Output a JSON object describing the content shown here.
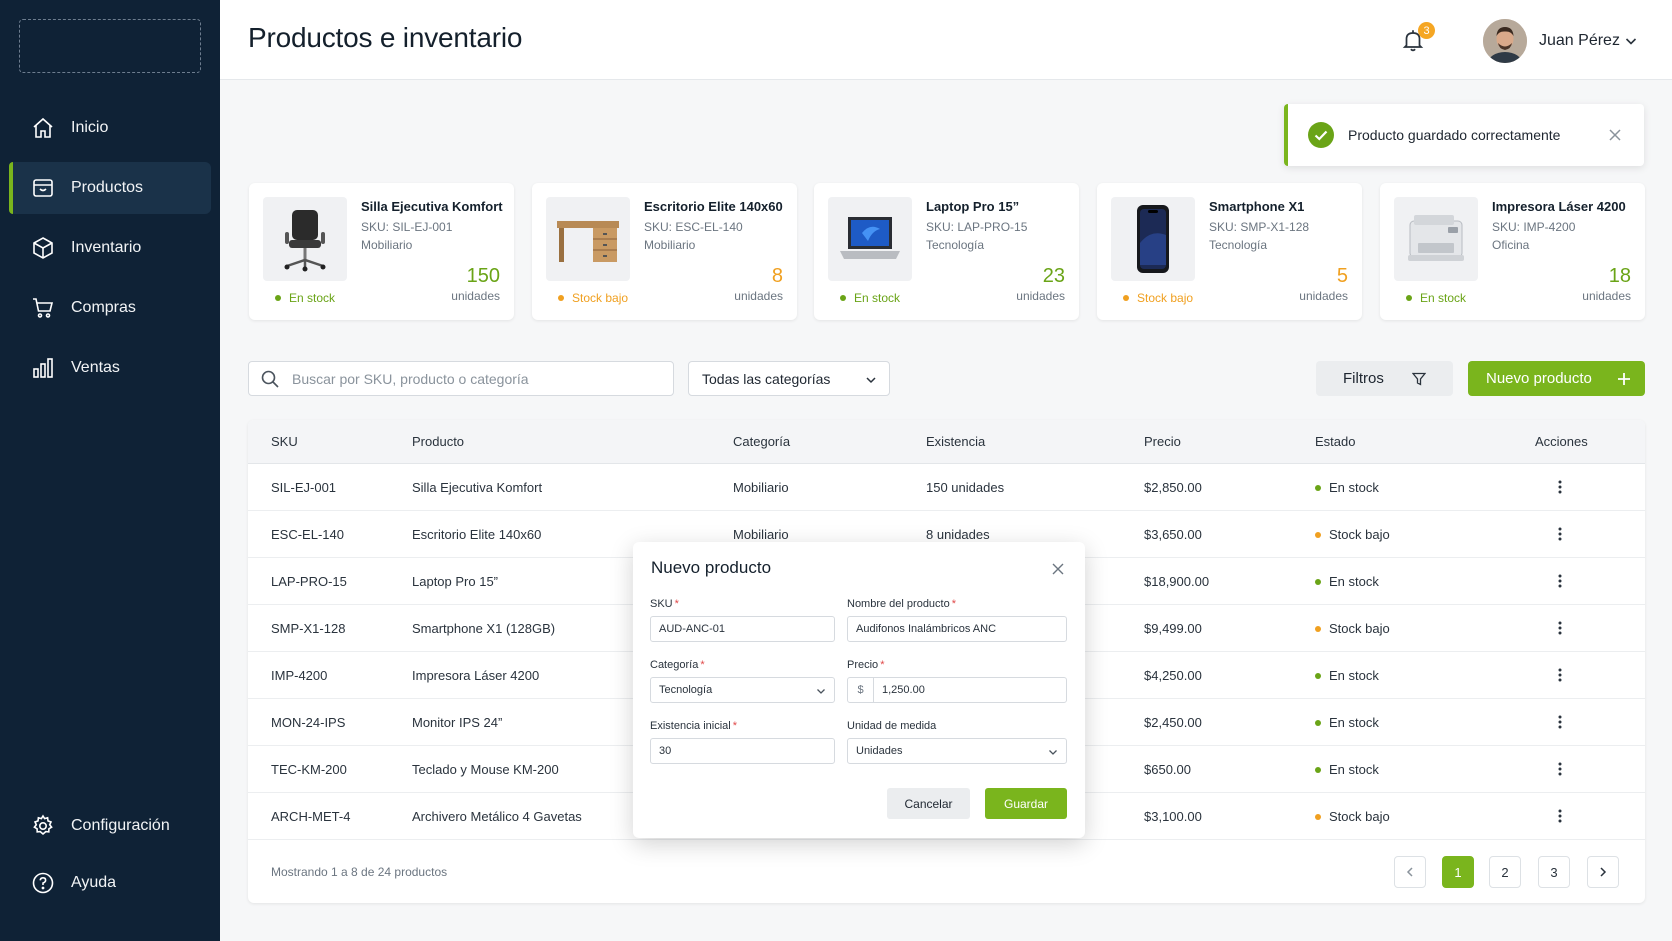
{
  "colors": {
    "sidebar_bg": "#0f2236",
    "accent_green": "#7ab51d",
    "status_green": "#6aa417",
    "status_orange": "#f0a020",
    "badge_orange": "#f5a623"
  },
  "sidebar": {
    "items": [
      {
        "label": "Inicio",
        "icon": "home-icon"
      },
      {
        "label": "Productos",
        "icon": "box-icon",
        "active": true
      },
      {
        "label": "Inventario",
        "icon": "cube-icon"
      },
      {
        "label": "Compras",
        "icon": "cart-icon"
      },
      {
        "label": "Ventas",
        "icon": "bar-chart-icon"
      }
    ],
    "bottom_items": [
      {
        "label": "Configuración",
        "icon": "gear-icon"
      },
      {
        "label": "Ayuda",
        "icon": "help-icon"
      }
    ]
  },
  "header": {
    "title": "Productos e inventario",
    "notification_count": "3",
    "user_name": "Juan Pérez"
  },
  "toast": {
    "message": "Producto guardado correctamente"
  },
  "cards": [
    {
      "name": "Silla Ejecutiva Komfort",
      "sku": "SKU: SIL-EJ-001",
      "category": "Mobiliario",
      "qty": "150",
      "unit": "unidades",
      "status": "En stock",
      "tone": "green",
      "icon": "office-chair-image"
    },
    {
      "name": "Escritorio Elite 140x60",
      "sku": "SKU: ESC-EL-140",
      "category": "Mobiliario",
      "qty": "8",
      "unit": "unidades",
      "status": "Stock bajo",
      "tone": "orange",
      "icon": "desk-image"
    },
    {
      "name": "Laptop Pro 15”",
      "sku": "SKU: LAP-PRO-15",
      "category": "Tecnología",
      "qty": "23",
      "unit": "unidades",
      "status": "En stock",
      "tone": "green",
      "icon": "laptop-image"
    },
    {
      "name": "Smartphone X1",
      "sku": "SKU: SMP-X1-128",
      "category": "Tecnología",
      "qty": "5",
      "unit": "unidades",
      "status": "Stock bajo",
      "tone": "orange",
      "icon": "smartphone-image"
    },
    {
      "name": "Impresora Láser 4200",
      "sku": "SKU: IMP-4200",
      "category": "Oficina",
      "qty": "18",
      "unit": "unidades",
      "status": "En stock",
      "tone": "green",
      "icon": "printer-image"
    }
  ],
  "toolbar": {
    "search_placeholder": "Buscar por SKU, producto o categoría",
    "category_select": "Todas las categorías",
    "filters_label": "Filtros",
    "new_product_label": "Nuevo producto"
  },
  "table": {
    "headers": [
      "SKU",
      "Producto",
      "Categoría",
      "Existencia",
      "Precio",
      "Estado",
      "Acciones"
    ],
    "rows": [
      {
        "sku": "SIL-EJ-001",
        "product": "Silla Ejecutiva Komfort",
        "category": "Mobiliario",
        "stock": "150 unidades",
        "price": "$2,850.00",
        "status": "En stock",
        "tone": "green"
      },
      {
        "sku": "ESC-EL-140",
        "product": "Escritorio Elite 140x60",
        "category": "Mobiliario",
        "stock": "8 unidades",
        "price": "$3,650.00",
        "status": "Stock bajo",
        "tone": "orange"
      },
      {
        "sku": "LAP-PRO-15",
        "product": "Laptop Pro 15”",
        "category": "",
        "stock": "",
        "price": "$18,900.00",
        "status": "En stock",
        "tone": "green"
      },
      {
        "sku": "SMP-X1-128",
        "product": "Smartphone X1 (128GB)",
        "category": "",
        "stock": "",
        "price": "$9,499.00",
        "status": "Stock bajo",
        "tone": "orange"
      },
      {
        "sku": "IMP-4200",
        "product": "Impresora Láser 4200",
        "category": "",
        "stock": "",
        "price": "$4,250.00",
        "status": "En stock",
        "tone": "green"
      },
      {
        "sku": "MON-24-IPS",
        "product": "Monitor IPS 24”",
        "category": "",
        "stock": "",
        "price": "$2,450.00",
        "status": "En stock",
        "tone": "green"
      },
      {
        "sku": "TEC-KM-200",
        "product": "Teclado y Mouse KM-200",
        "category": "",
        "stock": "",
        "price": "$650.00",
        "status": "En stock",
        "tone": "green"
      },
      {
        "sku": "ARCH-MET-4",
        "product": "Archivero Metálico 4 Gavetas",
        "category": "",
        "stock": "",
        "price": "$3,100.00",
        "status": "Stock bajo",
        "tone": "orange"
      }
    ],
    "showing": "Mostrando 1 a 8 de 24 productos",
    "pages": [
      "1",
      "2",
      "3"
    ],
    "current_page": "1"
  },
  "modal": {
    "title": "Nuevo producto",
    "sku_label": "SKU",
    "sku_value": "AUD-ANC-01",
    "name_label": "Nombre del producto",
    "name_value": "Audifonos Inalámbricos ANC",
    "category_label": "Categoría",
    "category_value": "Tecnología",
    "price_label": "Precio",
    "price_prefix": "$",
    "price_value": "1,250.00",
    "stock_label": "Existencia inicial",
    "stock_value": "30",
    "unit_label": "Unidad de medida",
    "unit_value": "Unidades",
    "required_mark": "*",
    "cancel_label": "Cancelar",
    "save_label": "Guardar"
  }
}
